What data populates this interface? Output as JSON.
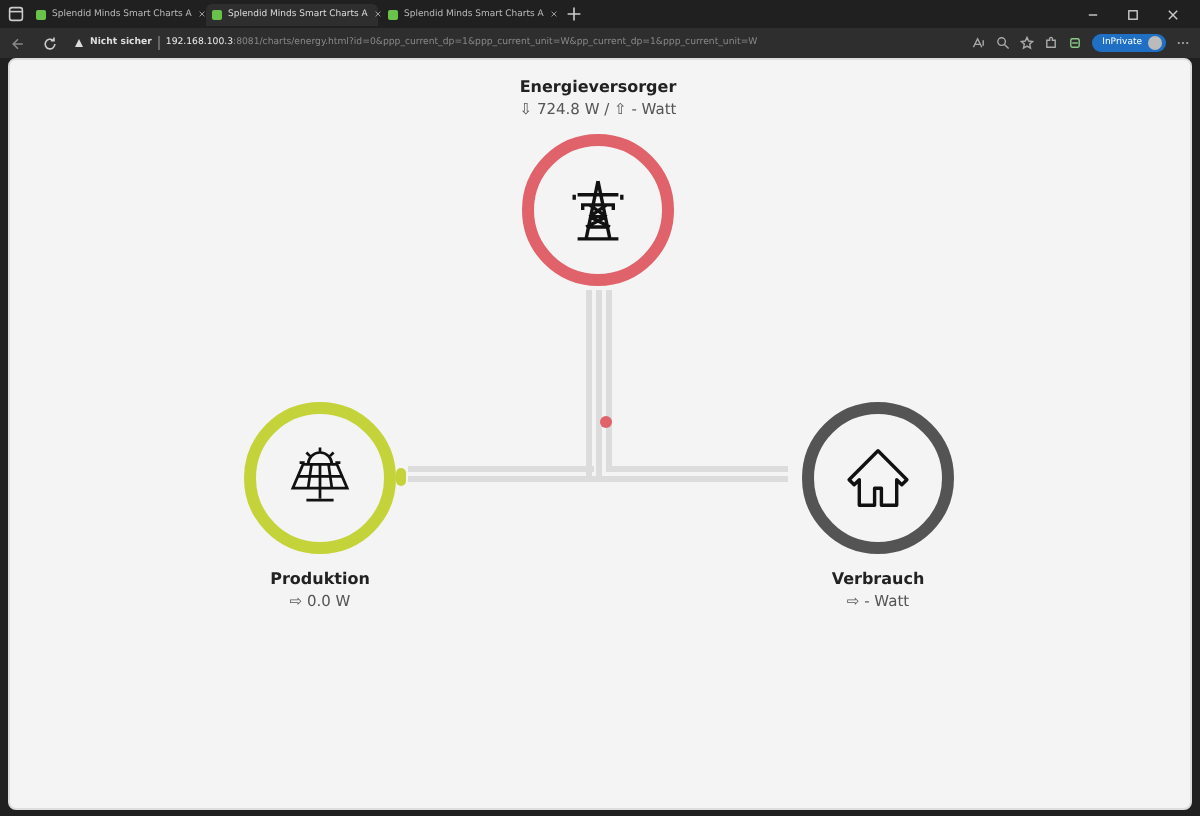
{
  "browser": {
    "tabs": [
      {
        "title": "Splendid Minds Smart Charts A",
        "selected": false
      },
      {
        "title": "Splendid Minds Smart Charts A",
        "selected": true
      },
      {
        "title": "Splendid Minds Smart Charts A",
        "selected": false
      }
    ],
    "security": "Nicht sicher",
    "host": "192.168.100.3",
    "path": ":8081/charts/energy.html?id=0&ppp_current_dp=1&ppp_current_unit=W&pp_current_dp=1&ppp_current_unit=W",
    "profile": "InPrivate"
  },
  "nodes": [
    {
      "kind": "grid",
      "title": "Energieversorger",
      "reading": "⇩ 724.8 W / ⇧ - Watt",
      "color": "#e0626a"
    },
    {
      "kind": "solar",
      "title": "Produktion",
      "reading": "⇨ 0.0 W",
      "color": "#c5d33a"
    },
    {
      "kind": "home",
      "title": "Verbrauch",
      "reading": "⇨ - Watt",
      "color": "#545454"
    }
  ]
}
